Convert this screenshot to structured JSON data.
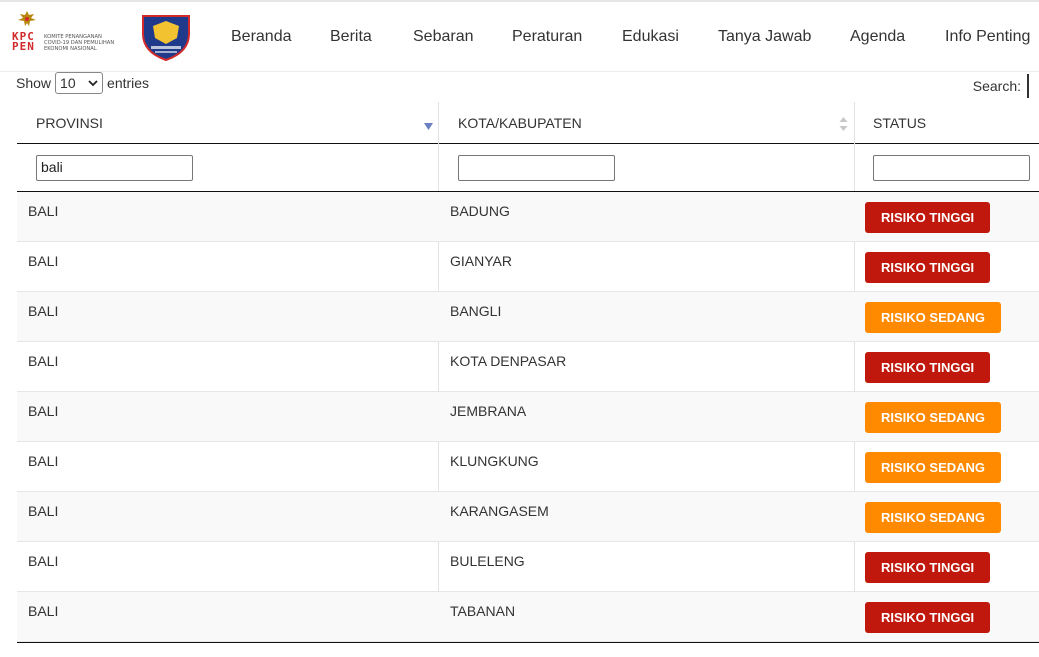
{
  "header": {
    "logo": {
      "letters_top": "KPC",
      "letters_bottom": "PEN",
      "line1": "KOMITE PENANGANAN",
      "line2": "COVID-19 DAN PEMULIHAN",
      "line3": "EKONOMI NASIONAL"
    },
    "nav": [
      "Beranda",
      "Berita",
      "Sebaran",
      "Peraturan",
      "Edukasi",
      "Tanya Jawab",
      "Agenda",
      "Info Penting"
    ]
  },
  "controls": {
    "show_label": "Show",
    "entries_value": "10",
    "entries_label": "entries",
    "search_label": "Search:"
  },
  "table": {
    "columns": [
      "PROVINSI",
      "KOTA/KABUPATEN",
      "STATUS"
    ],
    "filters": [
      "bali",
      "",
      ""
    ],
    "rows": [
      {
        "provinsi": "BALI",
        "kota": "BADUNG",
        "status": "RISIKO TINGGI",
        "level": "tinggi"
      },
      {
        "provinsi": "BALI",
        "kota": "GIANYAR",
        "status": "RISIKO TINGGI",
        "level": "tinggi"
      },
      {
        "provinsi": "BALI",
        "kota": "BANGLI",
        "status": "RISIKO SEDANG",
        "level": "sedang"
      },
      {
        "provinsi": "BALI",
        "kota": "KOTA DENPASAR",
        "status": "RISIKO TINGGI",
        "level": "tinggi"
      },
      {
        "provinsi": "BALI",
        "kota": "JEMBRANA",
        "status": "RISIKO SEDANG",
        "level": "sedang"
      },
      {
        "provinsi": "BALI",
        "kota": "KLUNGKUNG",
        "status": "RISIKO SEDANG",
        "level": "sedang"
      },
      {
        "provinsi": "BALI",
        "kota": "KARANGASEM",
        "status": "RISIKO SEDANG",
        "level": "sedang"
      },
      {
        "provinsi": "BALI",
        "kota": "BULELENG",
        "status": "RISIKO TINGGI",
        "level": "tinggi"
      },
      {
        "provinsi": "BALI",
        "kota": "TABANAN",
        "status": "RISIKO TINGGI",
        "level": "tinggi"
      }
    ]
  },
  "colors": {
    "risiko_tinggi": "#c0180c",
    "risiko_sedang": "#ff8a00",
    "sort_active": "#6a7fc4",
    "sort_inactive": "#c8c8c8"
  }
}
